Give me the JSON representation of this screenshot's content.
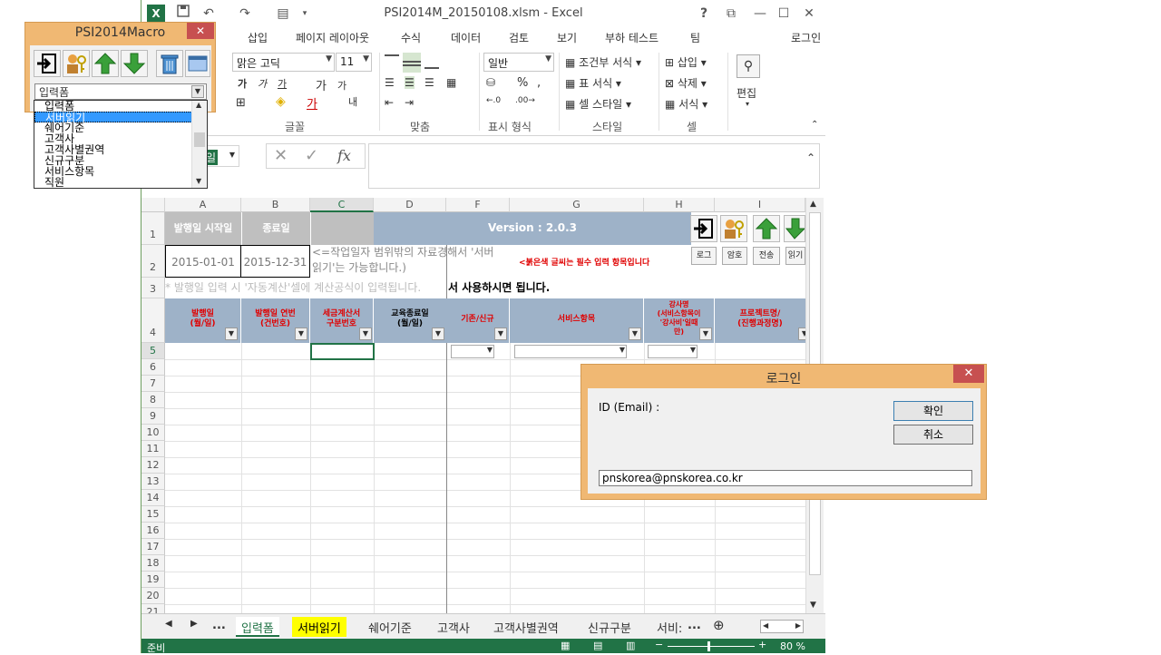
{
  "window": {
    "title": "PSI2014M_20150108.xlsm - Excel",
    "help": "?",
    "restore_ribbon": "⧉",
    "minimize": "—",
    "maximize": "☐",
    "close": "✕"
  },
  "ribbon": {
    "tabs": [
      "삽입",
      "페이지 레이아웃",
      "수식",
      "데이터",
      "검토",
      "보기",
      "부하 테스트",
      "팀"
    ],
    "login": "로그인",
    "font_name": "맑은 고딕",
    "font_size": "11",
    "number_format": "일반",
    "groups": {
      "font": "글꼴",
      "align": "맞춤",
      "number": "표시 형식",
      "style": "스타일",
      "cells": "셀"
    },
    "style_items": [
      "조건부 서식",
      "표 서식",
      "셀 스타일"
    ],
    "cell_items": [
      "삽입",
      "삭제",
      "서식"
    ],
    "edit": "편집",
    "format_buttons": [
      "가",
      "가",
      "가",
      "가",
      "가",
      "내"
    ]
  },
  "formula_bar": {
    "name_box_suffix": "일",
    "fx": "fx",
    "cancel": "✕",
    "enter": "✓"
  },
  "grid": {
    "columns": [
      "A",
      "B",
      "C",
      "D",
      "F",
      "G",
      "H",
      "I"
    ],
    "rows": [
      "1",
      "2",
      "3",
      "4",
      "5",
      "6",
      "7",
      "8",
      "9",
      "10",
      "11",
      "12",
      "13",
      "14",
      "15",
      "16",
      "17",
      "18",
      "19",
      "20",
      "21"
    ],
    "row1": {
      "start_label": "발행일 시작일",
      "end_label": "종료일",
      "version": "Version : 2.0.3"
    },
    "row2": {
      "start_value": "2015-01-01",
      "end_value": "2015-12-31",
      "note": "<=작업일자 범위밖의 자료경해서 '서버 읽기'는 가능합니다.)",
      "required_note": "<붉은색 글씨는 필수 입력 항목입니다",
      "buttons": [
        "로그",
        "암호",
        "전송",
        "읽기"
      ]
    },
    "row3": {
      "hint": "* 발행일 입력 시 '자동계산'셀에 계산공식이 입력됩니다.",
      "hint2": "서 사용하시면 됩니다."
    },
    "headers": [
      "발행일\n(월/일)",
      "발행일 연번\n(건번호)",
      "세금계산서\n구분번호",
      "교육종료일\n(월/일)",
      "기존/신규",
      "서비스항목",
      "강사명\n(서비스항목이\n'강사비'일때\n만)",
      "프로젝트명/\n(진행과정명)"
    ]
  },
  "sheet_tabs": {
    "nav": [
      "◀",
      "▶",
      "..."
    ],
    "tabs": [
      "입력폼",
      "서버읽기",
      "쉐어기준",
      "고객사",
      "고객사별권역",
      "신규구분",
      "서비:"
    ],
    "more": "...",
    "add": "⊕"
  },
  "status": {
    "ready": "준비",
    "zoom": "80 %"
  },
  "macro": {
    "title": "PSI2014Macro",
    "close": "✕",
    "selected": "입력폼",
    "options": [
      "입력폼",
      "서버읽기",
      "쉐어기준",
      "고객사",
      "고객사별권역",
      "신규구분",
      "서비스항목",
      "직원"
    ],
    "highlighted_index": 1
  },
  "login_dialog": {
    "title": "로그인",
    "close": "✕",
    "id_label": "ID (Email) :",
    "ok": "확인",
    "cancel": "취소",
    "email_value": "pnskorea@pnskorea.co.kr"
  },
  "colors": {
    "excel_green": "#217346",
    "dialog_orange": "#f0b873",
    "close_red": "#c75050",
    "header_gray": "#bfbfbf",
    "header_blue": "#9eb2c8",
    "required_red": "#e00000",
    "selected_blue": "#3399ff",
    "yellow_tab": "#ffff00"
  }
}
